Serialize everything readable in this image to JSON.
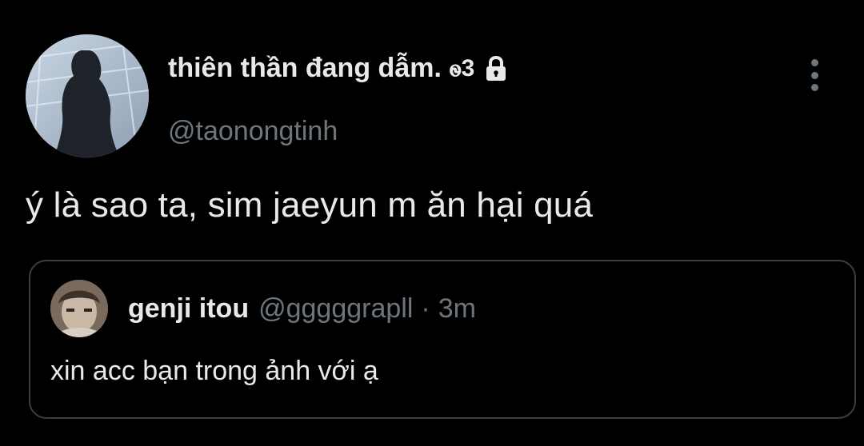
{
  "tweet": {
    "author": {
      "display_name": "thiên thần đang dẫm.",
      "name_symbol": "ꮻ3",
      "handle": "@taonongtinh",
      "avatar_icon": "silhouette-avatar",
      "protected_icon": "lock-icon"
    },
    "text": "ý là sao ta, sim jaeyun m ăn hại quá",
    "menu_icon": "more-vertical-icon"
  },
  "quoted_tweet": {
    "author": {
      "display_name": "genji itou",
      "handle": "@gggggrapll",
      "avatar_icon": "portrait-avatar"
    },
    "separator": "·",
    "time": "3m",
    "text": "xin acc bạn trong ảnh với ạ"
  },
  "colors": {
    "background": "#000000",
    "primary_text": "#e7e9ea",
    "secondary_text": "#6e767d",
    "border": "#3a3f44"
  }
}
